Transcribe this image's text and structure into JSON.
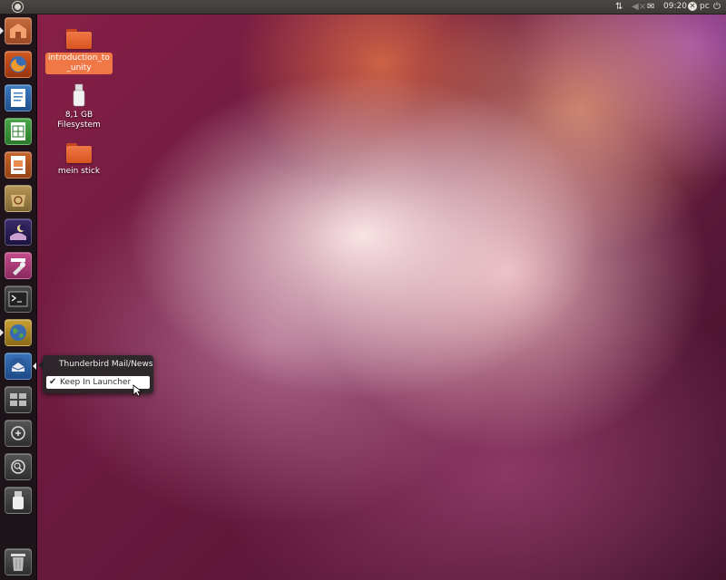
{
  "top_panel": {
    "clock": "09:20",
    "user": "pc",
    "icons": [
      "ubuntu-logo-icon",
      "network-icon",
      "volume-muted-icon",
      "mail-icon",
      "user-status-icon",
      "power-icon"
    ]
  },
  "launcher": {
    "items": [
      {
        "name": "home-folder",
        "icon": "home-folder-icon"
      },
      {
        "name": "firefox",
        "icon": "firefox-icon"
      },
      {
        "name": "libreoffice-writer",
        "icon": "writer-icon"
      },
      {
        "name": "libreoffice-calc",
        "icon": "calc-icon"
      },
      {
        "name": "libreoffice-impress",
        "icon": "impress-icon"
      },
      {
        "name": "ubuntu-software-center",
        "icon": "software-center-icon"
      },
      {
        "name": "ubuntu-one",
        "icon": "ubuntu-one-icon"
      },
      {
        "name": "system-settings",
        "icon": "settings-icon"
      },
      {
        "name": "terminal",
        "icon": "terminal-icon"
      },
      {
        "name": "web-browser",
        "icon": "globe-icon"
      },
      {
        "name": "thunderbird",
        "icon": "thunderbird-icon"
      },
      {
        "name": "workspace-switcher",
        "icon": "workspace-icon"
      },
      {
        "name": "dash-search",
        "icon": "search-icon"
      },
      {
        "name": "dash-files",
        "icon": "files-search-icon"
      },
      {
        "name": "usb-drive",
        "icon": "usb-drive-icon"
      },
      {
        "name": "trash",
        "icon": "trash-icon"
      }
    ]
  },
  "desktop": {
    "icons": [
      {
        "label": "introduction_to_unity",
        "type": "folder",
        "selected": true
      },
      {
        "label": "8,1 GB Filesystem",
        "type": "usb-drive",
        "selected": false
      },
      {
        "label": "mein stick",
        "type": "folder",
        "selected": false
      }
    ]
  },
  "quicklist": {
    "title": "Thunderbird Mail/News",
    "items": [
      {
        "label": "Keep In Launcher",
        "checked": true
      }
    ]
  },
  "colors": {
    "accent": "#f07746",
    "launcher_bg": "#161416",
    "panel_bg": "#3b3a36"
  }
}
